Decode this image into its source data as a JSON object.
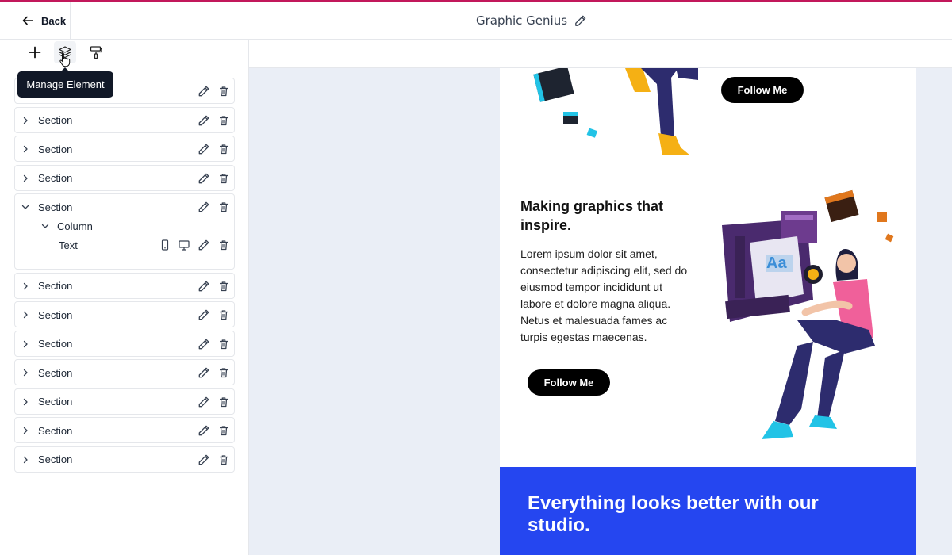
{
  "header": {
    "back_label": "Back",
    "title": "Graphic Genius"
  },
  "toolbar": {
    "tools": [
      "plus-icon",
      "layers-icon",
      "paint-roller-icon"
    ],
    "tooltip": "Manage Element"
  },
  "layers": {
    "items": [
      {
        "label": "Section",
        "expanded": false
      },
      {
        "label": "Section",
        "expanded": false
      },
      {
        "label": "Section",
        "expanded": false
      },
      {
        "label": "Section",
        "expanded": false
      },
      {
        "label": "Section",
        "expanded": true,
        "children": [
          {
            "label": "Column",
            "children": [
              {
                "label": "Text"
              }
            ]
          }
        ]
      },
      {
        "label": "Section",
        "expanded": false
      },
      {
        "label": "Section",
        "expanded": false
      },
      {
        "label": "Section",
        "expanded": false
      },
      {
        "label": "Section",
        "expanded": false
      },
      {
        "label": "Section",
        "expanded": false
      },
      {
        "label": "Section",
        "expanded": false
      },
      {
        "label": "Section",
        "expanded": false
      }
    ]
  },
  "email": {
    "button_top": "Follow Me",
    "heading": "Making graphics that inspire.",
    "body": "Lorem ipsum dolor sit amet, consectetur adipiscing elit, sed do eiusmod tempor incididunt ut labore et dolore magna aliqua. Netus et malesuada fames ac turpis egestas maecenas.",
    "button_mid": "Follow Me",
    "banner": "Everything looks better with our studio.",
    "illustration_text": "Aa"
  },
  "colors": {
    "accent_top": "#c2185b",
    "canvas_bg": "#eaeef6",
    "banner_bg": "#2546f0",
    "button_bg": "#000000"
  }
}
